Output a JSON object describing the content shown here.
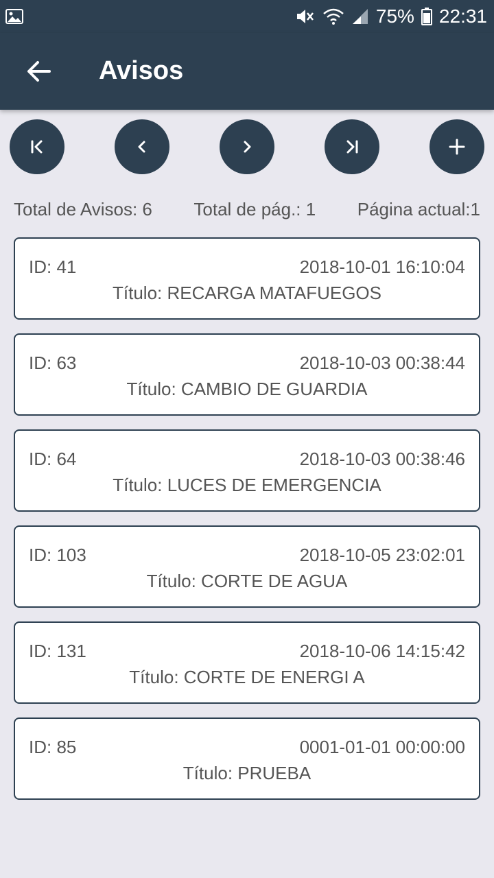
{
  "status_bar": {
    "battery": "75%",
    "time": "22:31",
    "icons": [
      "image-icon",
      "mute-icon",
      "wifi-icon",
      "signal-icon",
      "battery-icon"
    ]
  },
  "app_bar": {
    "title": "Avisos",
    "back_icon": "arrow-left-icon"
  },
  "nav_buttons": [
    {
      "name": "first-page-button",
      "icon": "first-page-icon"
    },
    {
      "name": "previous-page-button",
      "icon": "chevron-left-icon"
    },
    {
      "name": "next-page-button",
      "icon": "chevron-right-icon"
    },
    {
      "name": "last-page-button",
      "icon": "last-page-icon"
    },
    {
      "name": "add-button",
      "icon": "plus-icon"
    }
  ],
  "info": {
    "total_avisos": "Total de Avisos: 6",
    "total_pages": "Total de pág.: 1",
    "current_page": "Página actual:1"
  },
  "avisos": [
    {
      "id": "ID: 41",
      "date": "2018-10-01 16:10:04",
      "title": "Título: RECARGA MATAFUEGOS"
    },
    {
      "id": "ID: 63",
      "date": "2018-10-03 00:38:44",
      "title": "Título: CAMBIO DE GUARDIA"
    },
    {
      "id": "ID: 64",
      "date": "2018-10-03 00:38:46",
      "title": "Título: LUCES DE EMERGENCIA"
    },
    {
      "id": "ID: 103",
      "date": "2018-10-05 23:02:01",
      "title": "Título: CORTE DE AGUA"
    },
    {
      "id": "ID: 131",
      "date": "2018-10-06 14:15:42",
      "title": "Título: CORTE DE ENERGI A"
    },
    {
      "id": "ID: 85",
      "date": "0001-01-01 00:00:00",
      "title": "Título: PRUEBA"
    }
  ],
  "colors": {
    "primary": "#2d4051",
    "background": "#e9e8ef",
    "card": "#ffffff",
    "text": "#555555"
  }
}
